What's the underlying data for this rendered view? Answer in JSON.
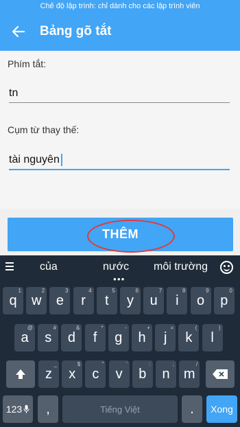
{
  "status_bar": {
    "text": "Chế độ lập trình: chỉ dành cho các lập trình viên"
  },
  "app_bar": {
    "title": "Bảng gõ tắt"
  },
  "form": {
    "shortcut_label": "Phím tắt:",
    "shortcut_value": "tn",
    "phrase_label": "Cụm từ thay thế:",
    "phrase_value": "tài nguyên"
  },
  "add_button": {
    "label": "THÊM"
  },
  "keyboard": {
    "suggestions": [
      "của",
      "nước",
      "môi trường"
    ],
    "row1": [
      {
        "k": "q",
        "h": "1"
      },
      {
        "k": "w",
        "h": "2"
      },
      {
        "k": "e",
        "h": "3"
      },
      {
        "k": "r",
        "h": "4"
      },
      {
        "k": "t",
        "h": "5"
      },
      {
        "k": "y",
        "h": "6"
      },
      {
        "k": "u",
        "h": "7"
      },
      {
        "k": "i",
        "h": "8"
      },
      {
        "k": "o",
        "h": "9"
      },
      {
        "k": "p",
        "h": "0"
      }
    ],
    "row2": [
      {
        "k": "a",
        "h": "@"
      },
      {
        "k": "s",
        "h": "#"
      },
      {
        "k": "d",
        "h": "&"
      },
      {
        "k": "f",
        "h": "*"
      },
      {
        "k": "g",
        "h": "-"
      },
      {
        "k": "h",
        "h": "+"
      },
      {
        "k": "j",
        "h": "="
      },
      {
        "k": "k",
        "h": "("
      },
      {
        "k": "l",
        "h": ")"
      }
    ],
    "row3": [
      {
        "k": "z",
        "h": "_"
      },
      {
        "k": "x",
        "h": "$"
      },
      {
        "k": "c",
        "h": "\""
      },
      {
        "k": "v",
        "h": "'"
      },
      {
        "k": "b",
        "h": ":"
      },
      {
        "k": "n",
        "h": ";"
      },
      {
        "k": "m",
        "h": "/"
      }
    ],
    "numbers_key": "123",
    "comma_key": ",",
    "space_label": "Tiếng Việt",
    "period_key": ".",
    "enter_label": "Xong",
    "shift_icon": "shift-arrow-icon",
    "backspace_icon": "backspace-icon",
    "mic_icon": "mic-icon",
    "emoji_icon": "emoji-icon",
    "menu_icon": "menu-icon"
  },
  "colors": {
    "primary": "#42a5f5",
    "keyboard_bg": "#1f2b38",
    "key_bg": "#3d4a5a",
    "highlight": "#e53935"
  }
}
